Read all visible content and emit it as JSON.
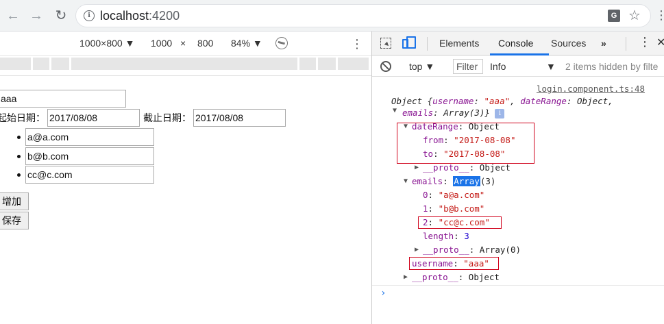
{
  "browser": {
    "url_host": "localhost",
    "url_port": ":4200"
  },
  "device_toolbar": {
    "preset": "1000×800 ▼",
    "width": "1000",
    "times": "×",
    "height": "800",
    "zoom": "84% ▼"
  },
  "form": {
    "username_value": "aaa",
    "start_label": "起始日期：",
    "start_value": "2017/08/08",
    "end_label": "截止日期：",
    "end_value": "2017/08/08",
    "emails": [
      "a@a.com",
      "b@b.com",
      "cc@c.com"
    ],
    "add_button": "增加",
    "save_button": "保存"
  },
  "devtools": {
    "tabs": [
      "Elements",
      "Console",
      "Sources"
    ],
    "more_tabs": "»",
    "active_tab": "Console",
    "context": "top",
    "filter_placeholder": "Filter",
    "level": "Info",
    "hidden_msg": "2 items hidden by filte",
    "source_link": "login.component.ts:48",
    "log": {
      "summary_line1_prefix": "Object {",
      "summary_key_username": "username",
      "summary_val_username": "\"aaa\"",
      "summary_key_dateRange": "dateRange",
      "summary_val_dateRange": "Object,",
      "summary_key_emails": "emails",
      "summary_val_emails": "Array(3)}",
      "dateRange_key": "dateRange",
      "dateRange_type": "Object",
      "from_key": "from",
      "from_val": "\"2017-08-08\"",
      "to_key": "to",
      "to_val": "\"2017-08-08\"",
      "proto_key": "__proto__",
      "proto_object": "Object",
      "emails_key": "emails",
      "emails_type": "Array",
      "emails_count": "(3)",
      "email_items": [
        {
          "index": "0",
          "value": "\"a@a.com\""
        },
        {
          "index": "1",
          "value": "\"b@b.com\""
        },
        {
          "index": "2",
          "value": "\"cc@c.com\""
        }
      ],
      "length_key": "length",
      "length_val": "3",
      "proto_array": "Array(0)",
      "username_key": "username",
      "username_val": "\"aaa\""
    },
    "prompt": "›"
  }
}
